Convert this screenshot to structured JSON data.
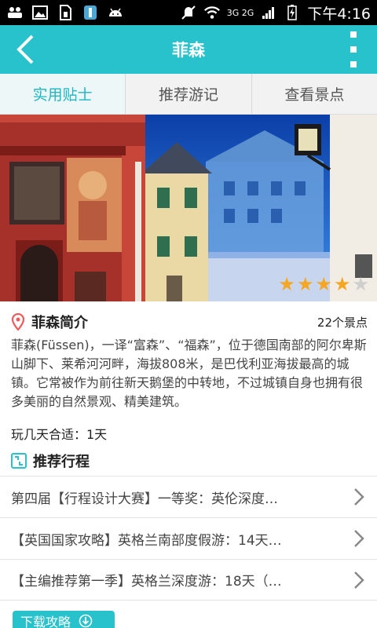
{
  "status_bar": {
    "carrier_tag": "3G 2G",
    "time": "下午4:16",
    "icons": [
      "people-icon",
      "image-icon",
      "sim-icon",
      "usb-icon",
      "android-icon",
      "mute-icon",
      "wifi-icon",
      "signal-icon",
      "battery-icon"
    ]
  },
  "header": {
    "title": "菲森"
  },
  "tabs": [
    {
      "label": "实用贴士",
      "active": true
    },
    {
      "label": "推荐游记",
      "active": false
    },
    {
      "label": "查看景点",
      "active": false
    }
  ],
  "banner": {
    "rating": 4,
    "rating_max": 5
  },
  "intro": {
    "title": "菲森简介",
    "count": "22个景点",
    "text": "菲森(Füssen)，一译“富森”、“福森”，位于德国南部的阿尔卑斯山脚下、莱希河河畔，海拔808米，是巴伐利亚海拔最高的城镇。它常被作为前往新天鹅堡的中转地，不过城镇自身也拥有很多美丽的自然景观、精美建筑。",
    "duration": "玩几天合适：1天"
  },
  "recommend": {
    "title": "推荐行程",
    "items": [
      "第四届【行程设计大赛】一等奖：英伦深度…",
      "【英国国家攻略】英格兰南部度假游：14天…",
      "【主编推荐第一季】英格兰深度游：18天（…"
    ]
  },
  "download": {
    "label": "下载攻略"
  },
  "colors": {
    "accent": "#27c2cc",
    "star": "#f5a623"
  }
}
